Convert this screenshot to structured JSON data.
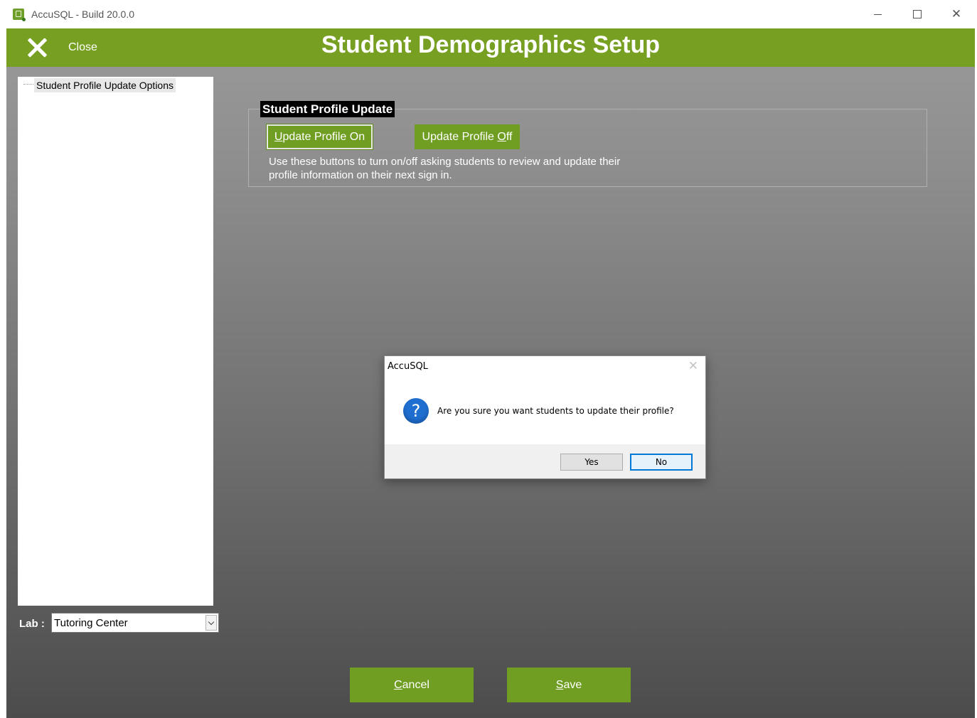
{
  "window": {
    "title": "AccuSQL - Build 20.0.0",
    "controls": {
      "minimize_icon": "minimize-icon",
      "maximize_icon": "maximize-icon",
      "close_icon": "close-icon",
      "close_glyph": "✕"
    }
  },
  "header": {
    "close_label": "Close",
    "title": "Student Demographics Setup",
    "color": "#77a022"
  },
  "sidebar": {
    "items": [
      {
        "label": "Student Profile Update Options"
      }
    ]
  },
  "lab": {
    "label": "Lab :",
    "selected": "Tutoring Center"
  },
  "profile_group": {
    "title": "Student Profile Update",
    "on_button": {
      "prefix": "",
      "mnemonic": "U",
      "rest": "pdate Profile On"
    },
    "off_button": {
      "prefix": "Update Profile ",
      "mnemonic": "O",
      "rest": "ff"
    },
    "description": "Use these buttons to turn on/off asking students to review and update their profile information on their next sign in."
  },
  "footer": {
    "cancel": {
      "mnemonic": "C",
      "rest": "ancel"
    },
    "save": {
      "mnemonic": "S",
      "rest": "ave"
    }
  },
  "dialog": {
    "title": "AccuSQL",
    "close_glyph": "✕",
    "icon_glyph": "?",
    "message": "Are you sure you want students to update their profile?",
    "yes_label": "Yes",
    "no_label": "No",
    "accent": "#0078d7"
  }
}
